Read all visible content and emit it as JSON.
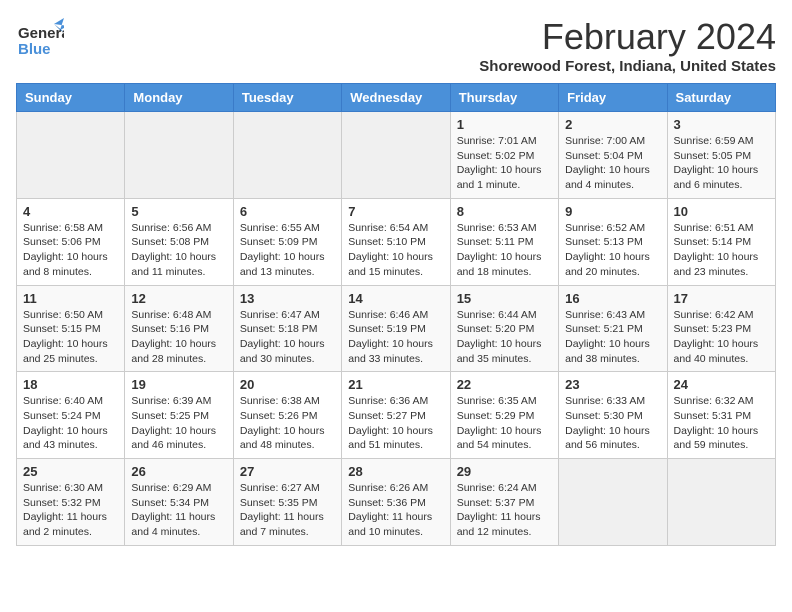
{
  "header": {
    "logo_general": "General",
    "logo_blue": "Blue",
    "month": "February 2024",
    "location": "Shorewood Forest, Indiana, United States"
  },
  "weekdays": [
    "Sunday",
    "Monday",
    "Tuesday",
    "Wednesday",
    "Thursday",
    "Friday",
    "Saturday"
  ],
  "weeks": [
    [
      {
        "day": "",
        "info": ""
      },
      {
        "day": "",
        "info": ""
      },
      {
        "day": "",
        "info": ""
      },
      {
        "day": "",
        "info": ""
      },
      {
        "day": "1",
        "info": "Sunrise: 7:01 AM\nSunset: 5:02 PM\nDaylight: 10 hours and 1 minute."
      },
      {
        "day": "2",
        "info": "Sunrise: 7:00 AM\nSunset: 5:04 PM\nDaylight: 10 hours and 4 minutes."
      },
      {
        "day": "3",
        "info": "Sunrise: 6:59 AM\nSunset: 5:05 PM\nDaylight: 10 hours and 6 minutes."
      }
    ],
    [
      {
        "day": "4",
        "info": "Sunrise: 6:58 AM\nSunset: 5:06 PM\nDaylight: 10 hours and 8 minutes."
      },
      {
        "day": "5",
        "info": "Sunrise: 6:56 AM\nSunset: 5:08 PM\nDaylight: 10 hours and 11 minutes."
      },
      {
        "day": "6",
        "info": "Sunrise: 6:55 AM\nSunset: 5:09 PM\nDaylight: 10 hours and 13 minutes."
      },
      {
        "day": "7",
        "info": "Sunrise: 6:54 AM\nSunset: 5:10 PM\nDaylight: 10 hours and 15 minutes."
      },
      {
        "day": "8",
        "info": "Sunrise: 6:53 AM\nSunset: 5:11 PM\nDaylight: 10 hours and 18 minutes."
      },
      {
        "day": "9",
        "info": "Sunrise: 6:52 AM\nSunset: 5:13 PM\nDaylight: 10 hours and 20 minutes."
      },
      {
        "day": "10",
        "info": "Sunrise: 6:51 AM\nSunset: 5:14 PM\nDaylight: 10 hours and 23 minutes."
      }
    ],
    [
      {
        "day": "11",
        "info": "Sunrise: 6:50 AM\nSunset: 5:15 PM\nDaylight: 10 hours and 25 minutes."
      },
      {
        "day": "12",
        "info": "Sunrise: 6:48 AM\nSunset: 5:16 PM\nDaylight: 10 hours and 28 minutes."
      },
      {
        "day": "13",
        "info": "Sunrise: 6:47 AM\nSunset: 5:18 PM\nDaylight: 10 hours and 30 minutes."
      },
      {
        "day": "14",
        "info": "Sunrise: 6:46 AM\nSunset: 5:19 PM\nDaylight: 10 hours and 33 minutes."
      },
      {
        "day": "15",
        "info": "Sunrise: 6:44 AM\nSunset: 5:20 PM\nDaylight: 10 hours and 35 minutes."
      },
      {
        "day": "16",
        "info": "Sunrise: 6:43 AM\nSunset: 5:21 PM\nDaylight: 10 hours and 38 minutes."
      },
      {
        "day": "17",
        "info": "Sunrise: 6:42 AM\nSunset: 5:23 PM\nDaylight: 10 hours and 40 minutes."
      }
    ],
    [
      {
        "day": "18",
        "info": "Sunrise: 6:40 AM\nSunset: 5:24 PM\nDaylight: 10 hours and 43 minutes."
      },
      {
        "day": "19",
        "info": "Sunrise: 6:39 AM\nSunset: 5:25 PM\nDaylight: 10 hours and 46 minutes."
      },
      {
        "day": "20",
        "info": "Sunrise: 6:38 AM\nSunset: 5:26 PM\nDaylight: 10 hours and 48 minutes."
      },
      {
        "day": "21",
        "info": "Sunrise: 6:36 AM\nSunset: 5:27 PM\nDaylight: 10 hours and 51 minutes."
      },
      {
        "day": "22",
        "info": "Sunrise: 6:35 AM\nSunset: 5:29 PM\nDaylight: 10 hours and 54 minutes."
      },
      {
        "day": "23",
        "info": "Sunrise: 6:33 AM\nSunset: 5:30 PM\nDaylight: 10 hours and 56 minutes."
      },
      {
        "day": "24",
        "info": "Sunrise: 6:32 AM\nSunset: 5:31 PM\nDaylight: 10 hours and 59 minutes."
      }
    ],
    [
      {
        "day": "25",
        "info": "Sunrise: 6:30 AM\nSunset: 5:32 PM\nDaylight: 11 hours and 2 minutes."
      },
      {
        "day": "26",
        "info": "Sunrise: 6:29 AM\nSunset: 5:34 PM\nDaylight: 11 hours and 4 minutes."
      },
      {
        "day": "27",
        "info": "Sunrise: 6:27 AM\nSunset: 5:35 PM\nDaylight: 11 hours and 7 minutes."
      },
      {
        "day": "28",
        "info": "Sunrise: 6:26 AM\nSunset: 5:36 PM\nDaylight: 11 hours and 10 minutes."
      },
      {
        "day": "29",
        "info": "Sunrise: 6:24 AM\nSunset: 5:37 PM\nDaylight: 11 hours and 12 minutes."
      },
      {
        "day": "",
        "info": ""
      },
      {
        "day": "",
        "info": ""
      }
    ]
  ]
}
